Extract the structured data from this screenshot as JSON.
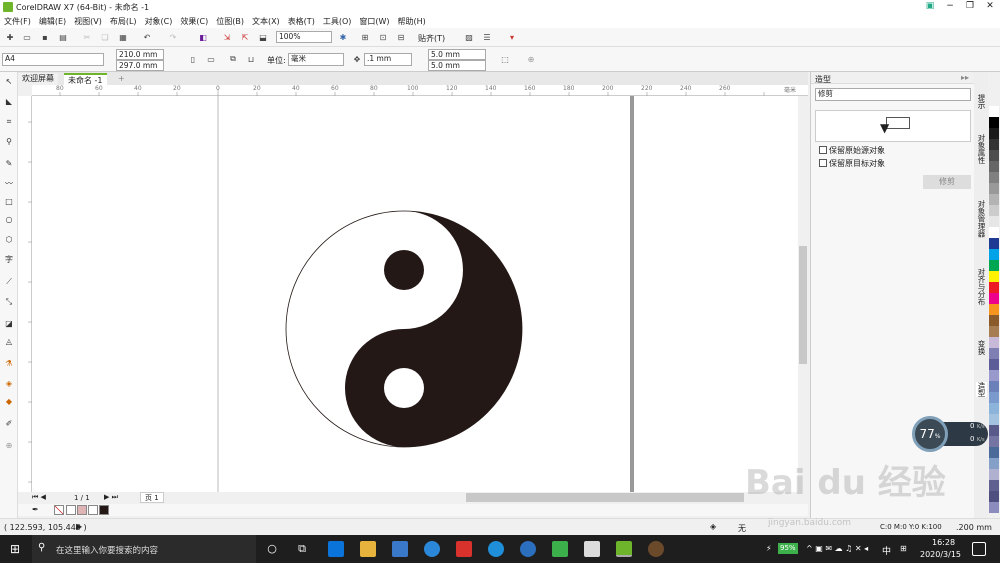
{
  "window": {
    "title": "CorelDRAW X7 (64-Bit) - 未命名 -1"
  },
  "menu": [
    "文件(F)",
    "编辑(E)",
    "视图(V)",
    "布局(L)",
    "对象(C)",
    "效果(C)",
    "位图(B)",
    "文本(X)",
    "表格(T)",
    "工具(O)",
    "窗口(W)",
    "帮助(H)"
  ],
  "toolbar": {
    "zoom": "100%",
    "snap": "贴齐(T)"
  },
  "propbar": {
    "page_size": "A4",
    "width": "210.0 mm",
    "height": "297.0 mm",
    "unit_label": "单位:",
    "unit": "毫米",
    "nudge": ".1 mm",
    "dup_x": "5.0 mm",
    "dup_y": "5.0 mm"
  },
  "tabs": {
    "welcome": "欢迎屏幕",
    "document": "未命名 -1",
    "add": "+"
  },
  "ruler": {
    "h_ticks": [
      "80",
      "60",
      "40",
      "20",
      "0",
      "20",
      "40",
      "60",
      "80",
      "100",
      "120",
      "140",
      "160",
      "180",
      "200",
      "220",
      "240",
      "260"
    ],
    "unit": "毫米"
  },
  "page_nav": {
    "pages": "1 / 1",
    "page_tab": "页 1"
  },
  "status": {
    "coords": "( 122.593, 105.449 )",
    "fill_none": "无",
    "stroke": "C:0 M:0 Y:0 K:100",
    "stroke_width": ".200 mm"
  },
  "docker": {
    "title": "造型",
    "mode": "修剪",
    "opt_source": "保留原始源对象",
    "opt_target": "保留原目标对象",
    "apply": "修剪"
  },
  "docker_tabs": [
    "提示",
    "对象属性",
    "对象管理器",
    "对齐与分布",
    "变换",
    "造型"
  ],
  "palette": [
    "#ffffff",
    "#000000",
    "#1a1a1a",
    "#333333",
    "#4d4d4d",
    "#666666",
    "#808080",
    "#999999",
    "#b3b3b3",
    "#cccccc",
    "#e6e6e6",
    "#ffffff",
    "#1f3a93",
    "#00a2e8",
    "#00a651",
    "#fff200",
    "#ed1c24",
    "#ec008c",
    "#f7941d",
    "#8b5a2b",
    "#a67c52",
    "#c8b9d8",
    "#7f7fb3",
    "#5c5c99",
    "#9999cc",
    "#6b7fb8",
    "#7a99cc",
    "#8cb3d9",
    "#a3c2e0",
    "#5a5a8a",
    "#7575a3",
    "#4a6a9a",
    "#85a0c8",
    "#b0b0d0",
    "#606090",
    "#4f4f7f",
    "#8b8bbd"
  ],
  "color_strip": [
    "#ffffff",
    "#e0b4b4",
    "#ffffff",
    "#231815"
  ],
  "speed": {
    "percent": "77",
    "unit": "%",
    "up": "0",
    "down": "0",
    "rate_unit": "K/s"
  },
  "watermark": {
    "brand": "Bai du 经验",
    "sub": "jingyan.baidu.com"
  },
  "taskbar": {
    "search_placeholder": "在这里输入你要搜索的内容",
    "battery": "95%",
    "ime": "中",
    "time": "16:28",
    "date": "2020/3/15"
  },
  "colors": {
    "yin": "#231815",
    "accent": "#6fb52c"
  }
}
